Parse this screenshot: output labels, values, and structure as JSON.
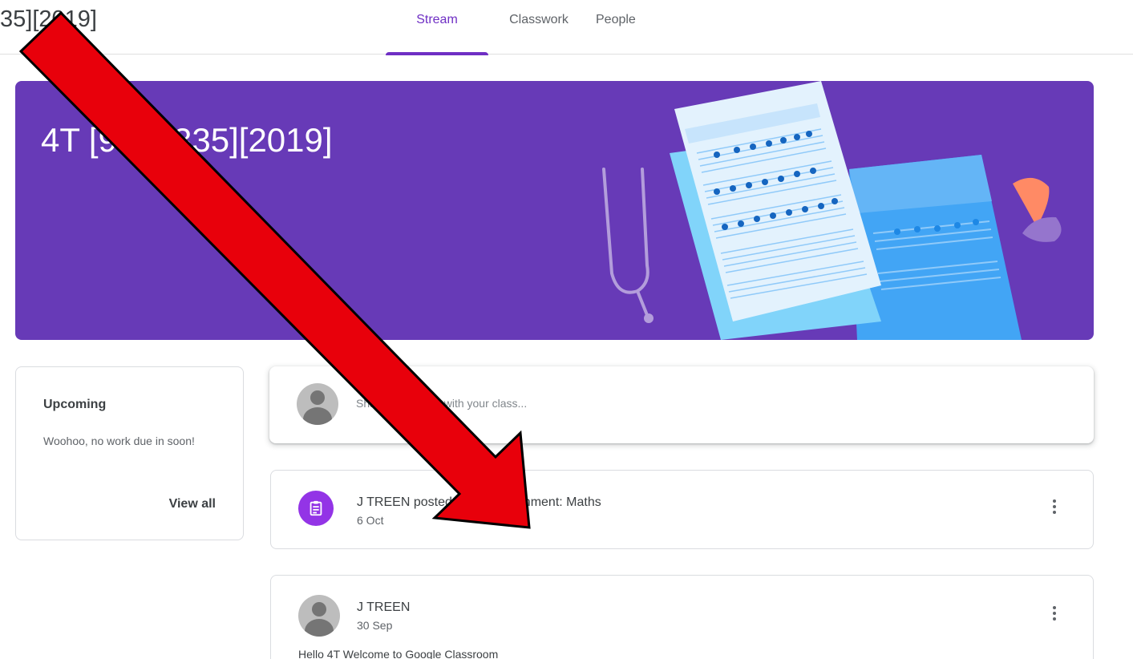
{
  "header": {
    "partial_title": "35][2019]",
    "tabs": [
      {
        "label": "Stream",
        "active": true
      },
      {
        "label": "Classwork",
        "active": false
      },
      {
        "label": "People",
        "active": false
      }
    ]
  },
  "banner": {
    "title": "4T [9362335][2019]",
    "color": "#673ab7"
  },
  "upcoming": {
    "title": "Upcoming",
    "message": "Woohoo, no work due in soon!",
    "view_all": "View all"
  },
  "share": {
    "placeholder": "Share something with your class..."
  },
  "posts": [
    {
      "title": "J TREEN posted a new assignment: Maths",
      "date": "6 Oct",
      "icon": "assignment-icon"
    },
    {
      "author": "J TREEN",
      "date": "30 Sep",
      "body": "Hello 4T Welcome to Google Classroom"
    }
  ],
  "colors": {
    "accent": "#6f2fc4",
    "assignment_icon_bg": "#9334e6",
    "annotation_arrow": "#e8000b"
  }
}
